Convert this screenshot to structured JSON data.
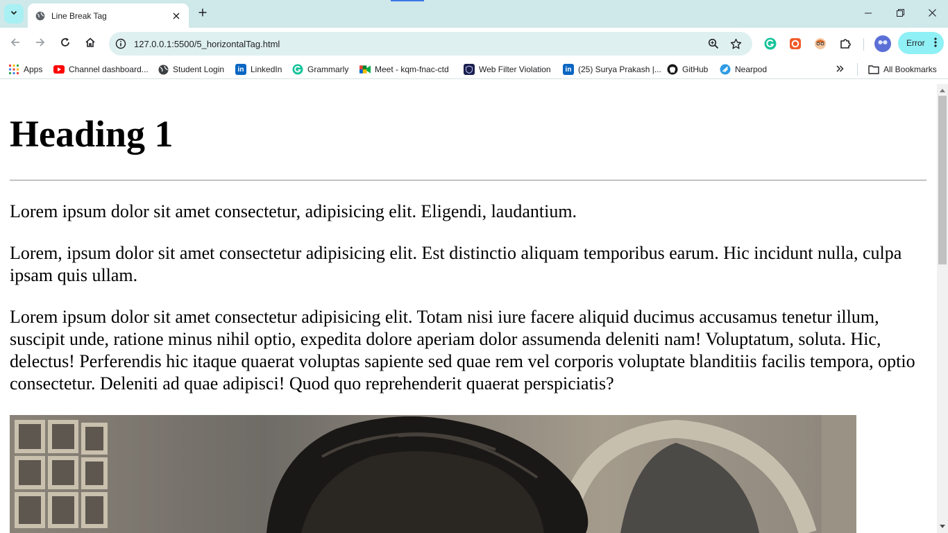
{
  "browser": {
    "tab_title": "Line Break Tag",
    "url": "127.0.0.1:5500/5_horizontalTag.html",
    "error_label": "Error",
    "bookmarks": [
      {
        "label": "Apps",
        "icon": "apps-grid-icon"
      },
      {
        "label": "Channel dashboard...",
        "icon": "youtube-icon"
      },
      {
        "label": "Student Login",
        "icon": "globe-icon"
      },
      {
        "label": "LinkedIn",
        "icon": "linkedin-icon"
      },
      {
        "label": "Grammarly",
        "icon": "grammarly-icon"
      },
      {
        "label": "Meet - kqm-fnac-ctd",
        "icon": "google-meet-icon"
      },
      {
        "label": "Web Filter Violation",
        "icon": "web-filter-icon"
      },
      {
        "label": "(25) Surya Prakash |...",
        "icon": "linkedin-icon"
      },
      {
        "label": "GitHub",
        "icon": "github-icon"
      },
      {
        "label": "Nearpod",
        "icon": "nearpod-icon"
      }
    ],
    "all_bookmarks_label": "All Bookmarks",
    "colors": {
      "tabstrip": "#cfe8ea",
      "omnibox": "#dff0f1",
      "error_button": "#8ff0f5"
    }
  },
  "page": {
    "heading": "Heading 1",
    "paragraphs": [
      "Lorem ipsum dolor sit amet consectetur, adipisicing elit. Eligendi, laudantium.",
      "Lorem, ipsum dolor sit amet consectetur adipisicing elit. Est distinctio aliquam temporibus earum. Hic incidunt nulla, culpa ipsam quis ullam.",
      "Lorem ipsum dolor sit amet consectetur adipisicing elit. Totam nisi iure facere aliquid ducimus accusamus tenetur illum, suscipit unde, ratione minus nihil optio, expedita dolore aperiam dolor assumenda deleniti nam! Voluptatum, soluta. Hic, delectus! Perferendis hic itaque quaerat voluptas sapiente sed quae rem vel corporis voluptate blanditiis facilis tempora, optio consectetur. Deleniti ad quae adipisci! Quod quo reprehenderit quaerat perspiciatis?"
    ]
  }
}
